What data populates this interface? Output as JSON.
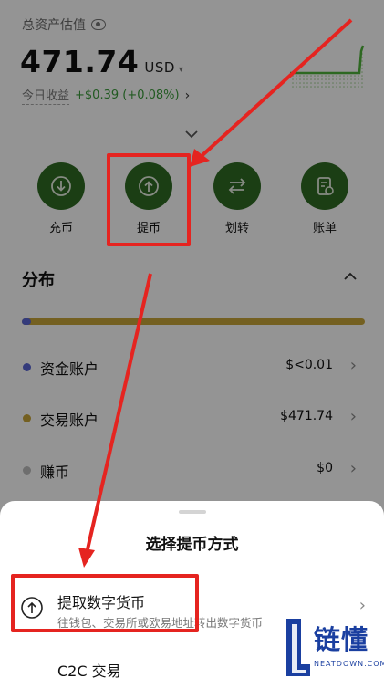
{
  "header": {
    "total_label": "总资产估值",
    "total_value": "471.74",
    "currency": "USD",
    "pnl_label": "今日收益",
    "pnl_value": "+$0.39 (+0.08%)",
    "pnl_arrow": "›",
    "pnl_color": "#3a9b3a"
  },
  "actions": [
    {
      "label": "充币",
      "icon": "download-icon"
    },
    {
      "label": "提币",
      "icon": "upload-icon"
    },
    {
      "label": "划转",
      "icon": "transfer-icon"
    },
    {
      "label": "账单",
      "icon": "bill-icon"
    }
  ],
  "accent_color": "#2f6b24",
  "distribution": {
    "title": "分布",
    "accounts": [
      {
        "name": "资金账户",
        "amount": "$<0.01",
        "color": "#5b67d4"
      },
      {
        "name": "交易账户",
        "amount": "$471.74",
        "color": "#c8a53a"
      },
      {
        "name": "赚币",
        "amount": "$0",
        "color": "#bdbdbd"
      }
    ]
  },
  "sheet": {
    "title": "选择提币方式",
    "methods": [
      {
        "title": "提取数字货币",
        "desc": "往钱包、交易所或欧易地址转出数字货币",
        "icon": "upload-icon"
      },
      {
        "title": "C2C 交易"
      }
    ]
  },
  "highlight_color": "#e52420",
  "watermark": {
    "text": "链懂",
    "sub": "NEATDOWN.COM",
    "color": "#1a3fa0"
  }
}
